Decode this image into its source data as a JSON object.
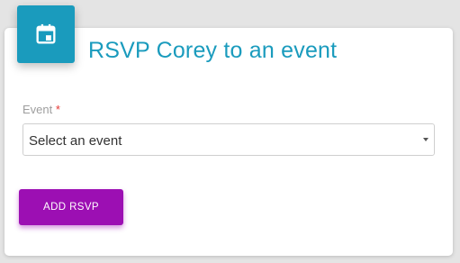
{
  "header": {
    "icon": "calendar-icon",
    "title": "RSVP Corey to an event",
    "accent_color": "#1a9bbd"
  },
  "form": {
    "event_label": "Event",
    "required_marker": "*",
    "event_select_value": "Select an event",
    "submit_label": "ADD RSVP",
    "submit_color": "#9c0fb3"
  }
}
